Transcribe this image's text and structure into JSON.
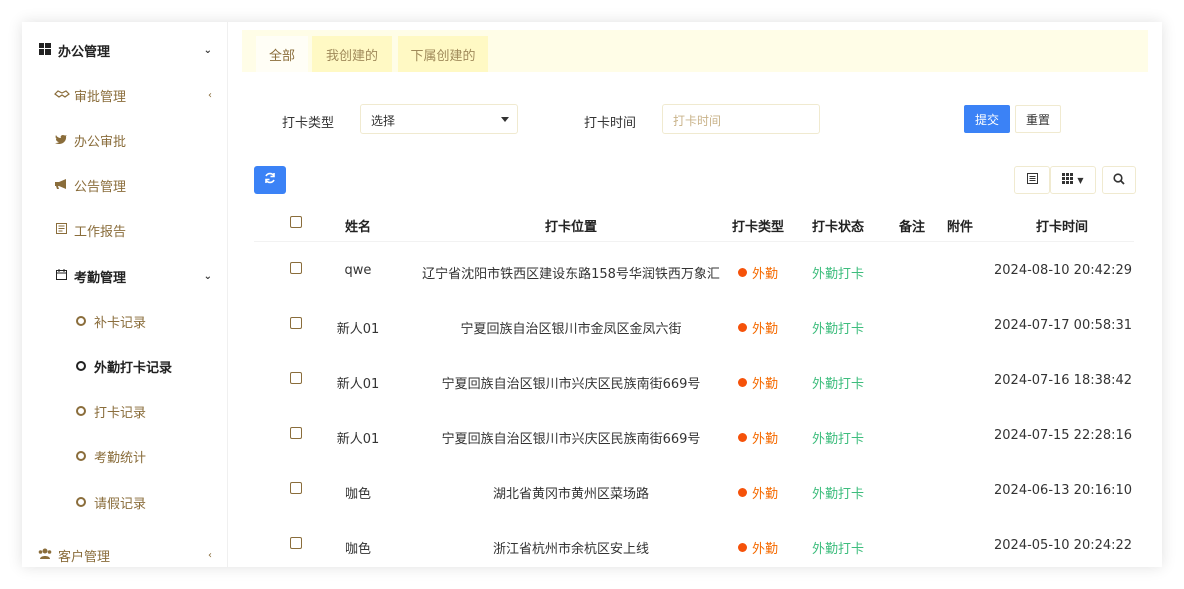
{
  "sidebar": {
    "items": [
      {
        "label": "办公管理",
        "icon": "windows-icon",
        "arrow": "⌄",
        "level": "top"
      },
      {
        "label": "审批管理",
        "icon": "handshake-icon",
        "arrow": "‹",
        "level": "second"
      },
      {
        "label": "办公审批",
        "icon": "twitter-icon",
        "arrow": "",
        "level": "second"
      },
      {
        "label": "公告管理",
        "icon": "bullhorn-icon",
        "arrow": "",
        "level": "second"
      },
      {
        "label": "工作报告",
        "icon": "report-icon",
        "arrow": "",
        "level": "second"
      },
      {
        "label": "考勤管理",
        "icon": "calendar-icon",
        "arrow": "⌄",
        "level": "second-open"
      }
    ],
    "attendance_sub": [
      "补卡记录",
      "外勤打卡记录",
      "打卡记录",
      "考勤统计",
      "请假记录"
    ],
    "active_sub": "外勤打卡记录",
    "customer": {
      "label": "客户管理",
      "icon": "users-icon",
      "arrow": "‹"
    }
  },
  "tabs": [
    "全部",
    "我创建的",
    "下属创建的"
  ],
  "filters": {
    "type_label": "打卡类型",
    "type_value": "选择",
    "time_label": "打卡时间",
    "time_placeholder": "打卡时间",
    "submit": "提交",
    "reset": "重置"
  },
  "toolbar": {
    "refresh_icon": "refresh-icon",
    "columns_icon": "list-icon",
    "grid_icon": "grid-icon",
    "search_icon": "search-icon"
  },
  "table": {
    "headers": [
      "姓名",
      "打卡位置",
      "打卡类型",
      "打卡状态",
      "备注",
      "附件",
      "打卡时间"
    ],
    "rows": [
      {
        "name": "qwe",
        "location": "辽宁省沈阳市铁西区建设东路158号华润铁西万象汇",
        "type": "外勤",
        "status": "外勤打卡",
        "note": "",
        "attachment": "",
        "time": "2024-08-10 20:42:29"
      },
      {
        "name": "新人01",
        "location": "宁夏回族自治区银川市金凤区金凤六街",
        "type": "外勤",
        "status": "外勤打卡",
        "note": "",
        "attachment": "",
        "time": "2024-07-17 00:58:31"
      },
      {
        "name": "新人01",
        "location": "宁夏回族自治区银川市兴庆区民族南街669号",
        "type": "外勤",
        "status": "外勤打卡",
        "note": "",
        "attachment": "",
        "time": "2024-07-16 18:38:42"
      },
      {
        "name": "新人01",
        "location": "宁夏回族自治区银川市兴庆区民族南街669号",
        "type": "外勤",
        "status": "外勤打卡",
        "note": "",
        "attachment": "",
        "time": "2024-07-15 22:28:16"
      },
      {
        "name": "咖色",
        "location": "湖北省黄冈市黄州区菜场路",
        "type": "外勤",
        "status": "外勤打卡",
        "note": "",
        "attachment": "",
        "time": "2024-06-13 20:16:10"
      },
      {
        "name": "咖色",
        "location": "浙江省杭州市余杭区安上线",
        "type": "外勤",
        "status": "外勤打卡",
        "note": "",
        "attachment": "",
        "time": "2024-05-10 20:24:22"
      }
    ]
  },
  "colors": {
    "accent": "#3b82f6",
    "brown": "#8a6d3b",
    "orange": "#f56a00",
    "green": "#3dbd7d",
    "tab_bg": "#fffde7"
  }
}
